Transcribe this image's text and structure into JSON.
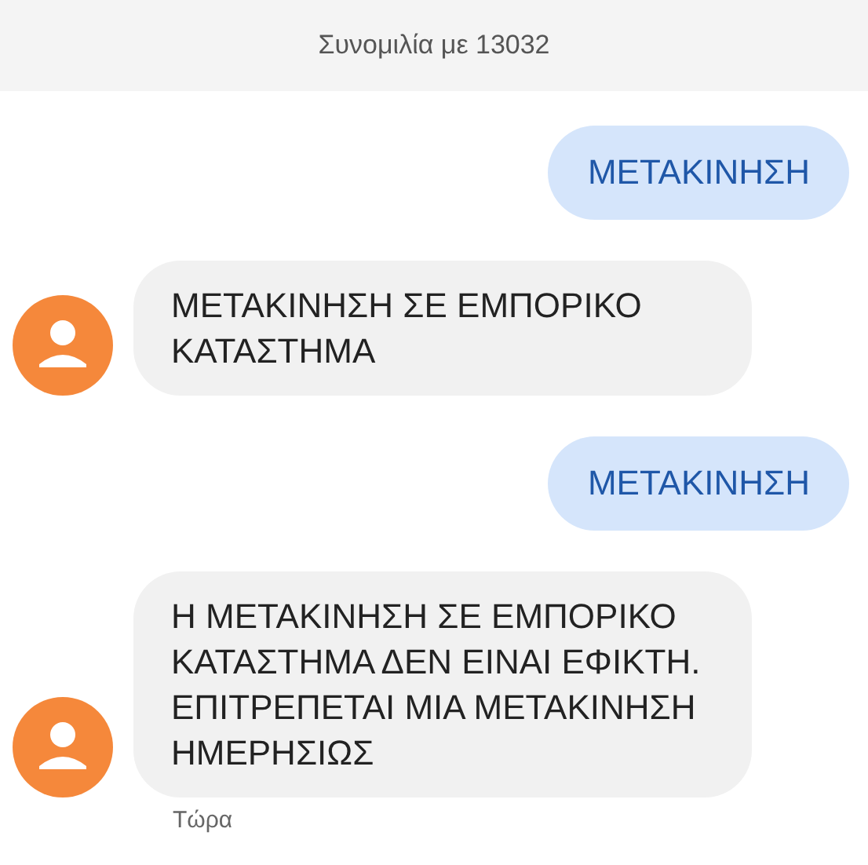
{
  "header": {
    "title": "Συνομιλία με 13032"
  },
  "messages": [
    {
      "kind": "outgoing",
      "text": "ΜΕΤΑΚΙΝΗΣΗ"
    },
    {
      "kind": "incoming",
      "text": "ΜΕΤΑΚΙΝΗΣΗ ΣΕ ΕΜΠΟΡΙΚΟ ΚΑΤΑΣΤΗΜΑ"
    },
    {
      "kind": "outgoing",
      "text": "ΜΕΤΑΚΙΝΗΣΗ"
    },
    {
      "kind": "incoming",
      "text": "Η ΜΕΤΑΚΙΝΗΣΗ ΣΕ ΕΜΠΟΡΙΚΟ ΚΑΤΑΣΤΗΜΑ ΔΕΝ ΕΙΝΑΙ ΕΦΙΚΤΗ. ΕΠΙΤΡΕΠΕΤΑΙ ΜΙΑ ΜΕΤΑΚΙΝΗΣΗ ΗΜΕΡΗΣΙΩΣ",
      "time": "Τώρα"
    }
  ]
}
